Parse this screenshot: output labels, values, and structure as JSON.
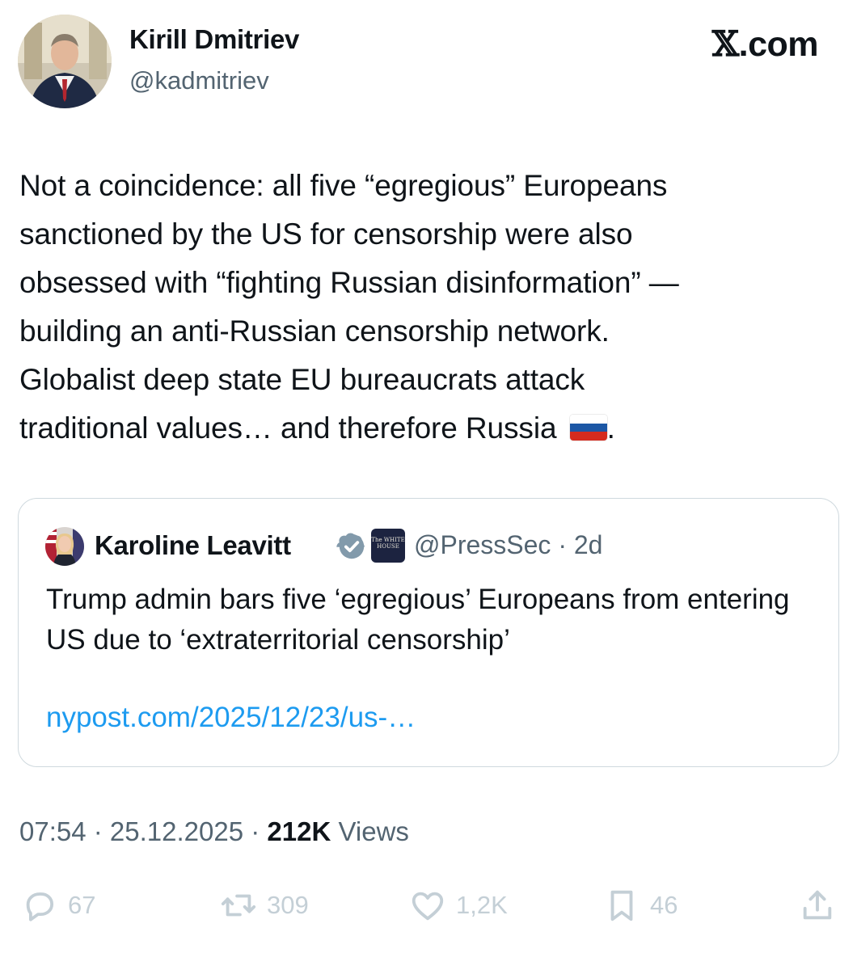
{
  "author": {
    "name": "Kirill Dmitriev",
    "handle": "@kadmitriev"
  },
  "source": {
    "glyph": "𝕏",
    "label": ".com"
  },
  "tweet": {
    "text": "Not a coincidence: all five “egregious” Europeans\nsanctioned by the US for censorship were also\nobsessed with “fighting Russian disinformation” —\nbuilding an anti-Russian censorship network.\nGlobalist deep state EU bureaucrats attack\ntraditional values… and therefore Russia",
    "flag_icon": "russia-flag-icon",
    "flag_colors": [
      "#ffffff",
      "#1c57a5",
      "#d52b1e"
    ],
    "trailing": "."
  },
  "quote": {
    "name": "Karoline Leavitt",
    "org_badge_text": "The WHITE HOUSE",
    "handle_time": "@PressSec · 2d",
    "text": "Trump admin bars five ‘egregious’ Europeans from entering US due to ‘extraterritorial censorship’",
    "link": "nypost.com/2025/12/23/us-…"
  },
  "meta": {
    "time": "07:54 · 25.12.2025 · ",
    "views_count": "212K",
    "views_label": " Views"
  },
  "actions": {
    "replies": "67",
    "reposts": "309",
    "likes": "1,2K",
    "bookmarks": "46"
  },
  "colors": {
    "text": "#0f1419",
    "secondary": "#536471",
    "link": "#1d9bf0",
    "verified": "#829aab",
    "action_gray": "#c4cfd6",
    "border": "#cfd9de"
  }
}
